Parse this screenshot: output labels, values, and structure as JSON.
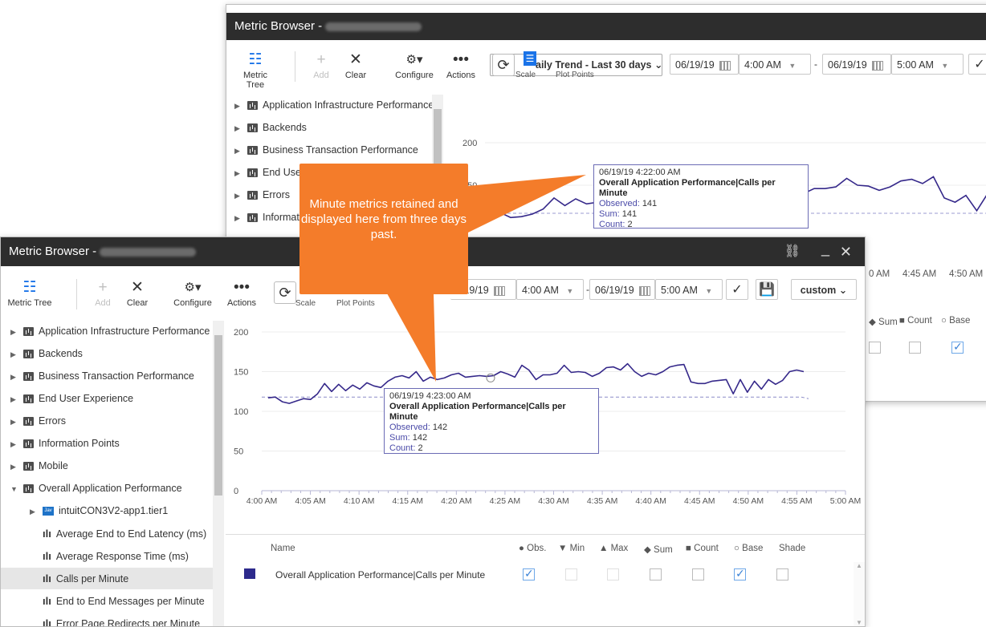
{
  "back_window": {
    "title": "Metric Browser -",
    "toolbar": {
      "metric_tree": "Metric Tree",
      "add": "Add",
      "clear": "Clear",
      "configure": "Configure",
      "actions": "Actions",
      "trend": "aily Trend - Last 30 days",
      "scale": "Scale",
      "plot_points": "Plot Points",
      "start_date": "06/19/19",
      "start_time": "4:00 AM",
      "end_date": "06/19/19",
      "end_time": "5:00 AM"
    },
    "tree": [
      "Application Infrastructure Performance",
      "Backends",
      "Business Transaction Performance",
      "End User E",
      "Errors",
      "Information"
    ],
    "y_ticks": [
      "200",
      "150",
      "0"
    ],
    "x_ticks_right": [
      "0 AM",
      "4:45 AM",
      "4:50 AM"
    ],
    "legend_partial": [
      "Sum",
      "Count",
      "Base"
    ],
    "tooltip": {
      "time": "06/19/19 4:22:00 AM",
      "metric": "Overall Application Performance|Calls per Minute",
      "observed_label": "Observed:",
      "observed": "141",
      "sum_label": "Sum:",
      "sum": "141",
      "count_label": "Count:",
      "count": "2"
    }
  },
  "front_window": {
    "title": "Metric Browser -",
    "toolbar": {
      "metric_tree": "Metric Tree",
      "add": "Add",
      "clear": "Clear",
      "configure": "Configure",
      "actions": "Actions",
      "scale": "Scale",
      "plot_points": "Plot Points",
      "start_date": "6/19/19",
      "start_time": "4:00 AM",
      "end_date": "06/19/19",
      "end_time": "5:00 AM",
      "range": "custom"
    },
    "tree": [
      {
        "label": "Application Infrastructure Performance",
        "type": "folder",
        "indent": 0
      },
      {
        "label": "Backends",
        "type": "folder",
        "indent": 0
      },
      {
        "label": "Business Transaction Performance",
        "type": "folder",
        "indent": 0
      },
      {
        "label": "End User Experience",
        "type": "folder",
        "indent": 0
      },
      {
        "label": "Errors",
        "type": "folder",
        "indent": 0
      },
      {
        "label": "Information Points",
        "type": "folder",
        "indent": 0
      },
      {
        "label": "Mobile",
        "type": "folder",
        "indent": 0
      },
      {
        "label": "Overall Application Performance",
        "type": "folder-open",
        "indent": 0
      },
      {
        "label": "intuitCON3V2-app1.tier1",
        "type": "jvm",
        "indent": 1
      },
      {
        "label": "Average End to End Latency (ms)",
        "type": "metric",
        "indent": 1
      },
      {
        "label": "Average Response Time (ms)",
        "type": "metric",
        "indent": 1
      },
      {
        "label": "Calls per Minute",
        "type": "metric",
        "indent": 1,
        "selected": true
      },
      {
        "label": "End to End Messages per Minute",
        "type": "metric",
        "indent": 1
      },
      {
        "label": "Error Page Redirects per Minute",
        "type": "metric",
        "indent": 1
      }
    ],
    "chart_data": {
      "type": "line",
      "ylim": [
        0,
        200
      ],
      "y_ticks": [
        "0",
        "50",
        "100",
        "150",
        "200"
      ],
      "x_ticks": [
        "4:00 AM",
        "4:05 AM",
        "4:10 AM",
        "4:15 AM",
        "4:20 AM",
        "4:25 AM",
        "4:30 AM",
        "4:35 AM",
        "4:40 AM",
        "4:45 AM",
        "4:50 AM",
        "4:55 AM",
        "5:00 AM"
      ],
      "series_color": "#35288a",
      "baseline_color": "#8c8cc8",
      "values": [
        117,
        118,
        112,
        110,
        113,
        116,
        115,
        122,
        135,
        125,
        134,
        126,
        133,
        128,
        136,
        132,
        130,
        138,
        143,
        145,
        142,
        150,
        138,
        143,
        140,
        142,
        146,
        148,
        143,
        144,
        145,
        144,
        145,
        150,
        147,
        143,
        158,
        152,
        140,
        146,
        146,
        148,
        158,
        149,
        150,
        149,
        144,
        148,
        155,
        156,
        152,
        160,
        150,
        144,
        148,
        146,
        150,
        156,
        158,
        159,
        137,
        135,
        135,
        138,
        139,
        140,
        122,
        140,
        124,
        138,
        128,
        140,
        134,
        139,
        150,
        152,
        150
      ],
      "baseline": [
        118,
        118,
        118,
        118,
        118,
        118,
        118,
        118,
        118,
        118,
        118,
        118,
        118,
        118,
        118,
        118,
        118,
        118,
        118,
        118,
        118,
        118,
        118,
        118,
        118,
        118,
        118,
        118,
        118,
        118,
        118,
        118,
        118,
        118,
        118,
        118,
        118,
        118,
        118,
        118,
        118,
        118,
        118,
        118,
        118,
        118,
        118,
        118,
        118,
        118,
        118,
        118,
        118,
        118,
        118,
        118,
        118,
        118,
        118,
        118,
        118,
        118,
        118,
        118,
        118,
        118,
        118,
        118,
        118,
        118,
        118,
        118,
        118,
        118,
        118,
        118,
        116
      ]
    },
    "tooltip": {
      "time": "06/19/19 4:23:00 AM",
      "metric": "Overall Application Performance|Calls per Minute",
      "observed_label": "Observed:",
      "observed": "142",
      "sum_label": "Sum:",
      "sum": "142",
      "count_label": "Count:",
      "count": "2"
    },
    "legend": {
      "name_header": "Name",
      "columns": [
        "Obs.",
        "Min",
        "Max",
        "Sum",
        "Count",
        "Base",
        "Shade"
      ],
      "row_name": "Overall Application Performance|Calls per Minute",
      "row_color": "#2d2a8c"
    }
  },
  "callout": {
    "text": "Minute metrics retained and displayed here from three days past."
  }
}
